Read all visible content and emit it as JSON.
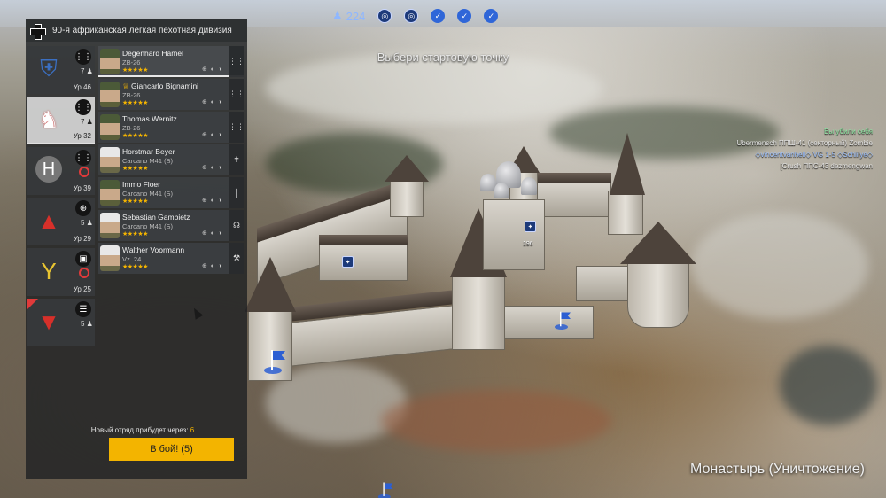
{
  "top_bar": {
    "reinforcements_count": "224",
    "objectives": [
      {
        "type": "capture",
        "icon": "target-icon"
      },
      {
        "type": "capture",
        "icon": "target-icon"
      },
      {
        "type": "captured",
        "icon": "check-icon"
      },
      {
        "type": "captured",
        "icon": "check-icon"
      },
      {
        "type": "captured",
        "icon": "check-icon"
      }
    ]
  },
  "hint": "Выбери стартовую точку",
  "division": {
    "title": "90-я африканская лёгкая пехотная дивизия"
  },
  "squads": [
    {
      "emblem": "shield-eagle-icon",
      "class_icon": "infantry-icon",
      "count": "7",
      "level": "Ур 46",
      "state": "normal"
    },
    {
      "emblem": "white-figure-icon",
      "class_icon": "infantry-icon",
      "count": "7",
      "level": "Ур 32",
      "state": "selected"
    },
    {
      "emblem": "h-emblem-icon",
      "class_icon": "infantry-icon",
      "count": "",
      "level": "Ур 39",
      "state": "blocked"
    },
    {
      "emblem": "red-triangle-icon",
      "class_icon": "crosshair-icon",
      "count": "5",
      "level": "Ур 29",
      "state": "normal"
    },
    {
      "emblem": "yellow-fork-icon",
      "class_icon": "vehicle-icon",
      "count": "",
      "level": "Ур 25",
      "state": "blocked"
    },
    {
      "emblem": "red-wings-icon",
      "class_icon": "clipboard-icon",
      "count": "5",
      "level": "",
      "state": "new"
    }
  ],
  "soldiers": [
    {
      "name": "Degenhard Hamel",
      "weapon": "ZB-26",
      "stars": "★★★★★",
      "role_icon": "mg-icon",
      "face": "helmet",
      "selected": true,
      "gear": "⊕ ◐ ◑"
    },
    {
      "name": "Giancarlo Bignamini",
      "weapon": "ZB-26",
      "stars": "★★★★★",
      "role_icon": "mg-icon",
      "face": "helmet",
      "selected": false,
      "gear": "⊕ ◐ ◑"
    },
    {
      "name": "Thomas Wernitz",
      "weapon": "ZB-26",
      "stars": "★★★★★",
      "role_icon": "mg-icon",
      "face": "helmet",
      "selected": false,
      "gear": "⊕ ◐ ◑"
    },
    {
      "name": "Horstmar Beyer",
      "weapon": "Carcano M41 (Б)",
      "stars": "★★★★★",
      "role_icon": "medic-icon",
      "face": "white",
      "selected": false,
      "gear": "⊕ ◐ ◑"
    },
    {
      "name": "Immo Floer",
      "weapon": "Carcano M41 (Б)",
      "stars": "★★★★★",
      "role_icon": "rifle-icon",
      "face": "helmet",
      "selected": false,
      "gear": "⊕ ◐ ◑"
    },
    {
      "name": "Sebastian Gambietz",
      "weapon": "Carcano M41 (Б)",
      "stars": "★★★★★",
      "role_icon": "radio-icon",
      "face": "white",
      "selected": false,
      "gear": "⊕ ◐ ◑"
    },
    {
      "name": "Walther Voormann",
      "weapon": "Vz. 24",
      "stars": "★★★★★",
      "role_icon": "wrench-icon",
      "face": "white",
      "selected": false,
      "gear": "⊕ ◐ ◑"
    }
  ],
  "arrival": {
    "label": "Новый отряд прибудет через:",
    "seconds": "6"
  },
  "battle_button": "В бой! (5)",
  "kill_feed": [
    {
      "text": "Вы убили себя",
      "style": "first"
    },
    {
      "text": "Ubermensch ППШ-41 (секторный) Zombie",
      "style": "normal"
    },
    {
      "text": "◇vincentvanhell◇ VG 1-5 ◇Schlilye◇",
      "style": "blue"
    },
    {
      "text": "[Crush ППС-43 dezmengwan",
      "style": "normal"
    }
  ],
  "map_points": [
    {
      "label": "196"
    }
  ],
  "map_title": "Монастырь (Уничтожение)"
}
